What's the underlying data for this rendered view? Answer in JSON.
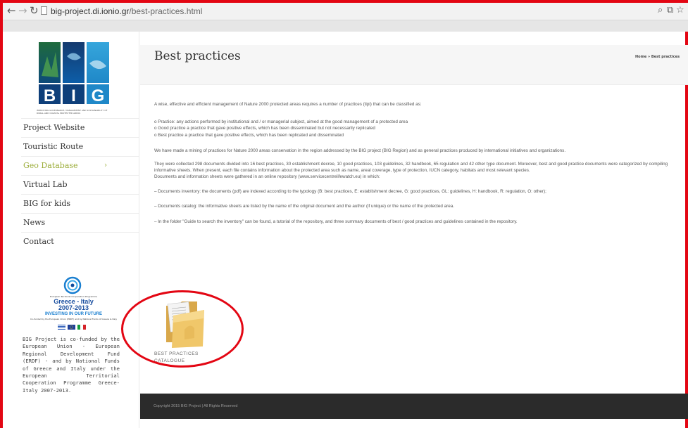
{
  "browser": {
    "domain": "big-project.di.ionio.gr",
    "path": "/best-practices.html"
  },
  "sidebar": {
    "logo_text": "BIG",
    "logo_letters": [
      "B",
      "I",
      "G"
    ],
    "logo_caption": "IMPROVING GOVERNANCE, MANAGEMENT AND SUSTAINABILITY OF RURAL AND COASTAL PROTECTED AREAS",
    "menu": [
      {
        "label": "Project Website"
      },
      {
        "label": "Touristic Route"
      },
      {
        "label": "Geo Database",
        "chevron": "›"
      },
      {
        "label": "Virtual Lab"
      },
      {
        "label": "BIG for kids"
      },
      {
        "label": "News"
      },
      {
        "label": "Contact"
      }
    ],
    "active_item": "Geo Database",
    "accent_color": "#9cad3a",
    "eu_program_small": "European Territorial Cooperation Programme",
    "eu_program_name_1": "Greece - Italy",
    "eu_program_name_2": "2007-2013",
    "eu_invest": "INVESTING IN OUR FUTURE",
    "eu_fund_text": "Co-funded by the European Union (ERDF) and by National Funds of Greece & Italy",
    "cofund_text": "BIG Project is co-funded by the European Union - European Regional Development Fund (ERDF) - and by National Funds of Greece and Italy under the European Territorial Cooperation Programme Greece-Italy 2007-2013."
  },
  "page": {
    "title": "Best practices",
    "breadcrumb": "Home » Best practices",
    "intro": "A wise, effective and efficient management of Nature 2000 protected areas requires a number of practices (tipi) that can be classified as:",
    "definitions": [
      "o Practice: any actions performed by institutional and / or managerial subject, aimed at the good management of a protected area",
      "o Good practice a practice that gave positive effects, which has been disseminated but not necessarily replicated",
      "o Best practice a practice that gave positive effects, which has been replicated and disseminated"
    ],
    "paragraph_mining": "We have made a mining of practices for Nature 2000 areas conservation in the region addressed by the BIG project (BIG Region) and as general practices produced by international initiatives and organizations.",
    "paragraph_collected": "They were collected 298 documents divided into 16 best practices, 30 establishment decree, 10 good practices, 103 guidelines, 32 handbook, 65 regulation and 42 other type document. Moreover, best and good practice documents were categorized by compiling informative sheets. When present, each file contains information about the protected area such as name, areal coverage, type of protection, IUCN category, habitats and most relevant species.",
    "paragraph_repository": "Documents and information sheets were gathered in an online repository (www.servicecentrelifewatch.eu) in which:",
    "bullet_inventory": "– Documents inventory: the documents (pdf) are indexed according to the typology (B: best practices, E: establishment decree, G: good practices, GL: guidelines, H: handbook, R: regulation, O: other);",
    "bullet_catalog": "– Documents catalog: the informative sheets are listed by the name of the original document and the author (if unique) or the name of the protected area.",
    "bullet_folder": "– In the folder \"Guide to search the inventory\" can be found, a tutorial of the repository, and three summary documents of best / good practices and guidelines contained in the repository.",
    "catalogue_label_1": "BEST PRACTICES",
    "catalogue_label_2": "CATALOGUE"
  },
  "footer": {
    "copyright": "Copyright 2015 BIG Project | All Rights Reserved"
  },
  "annotation_color": "#e30613"
}
